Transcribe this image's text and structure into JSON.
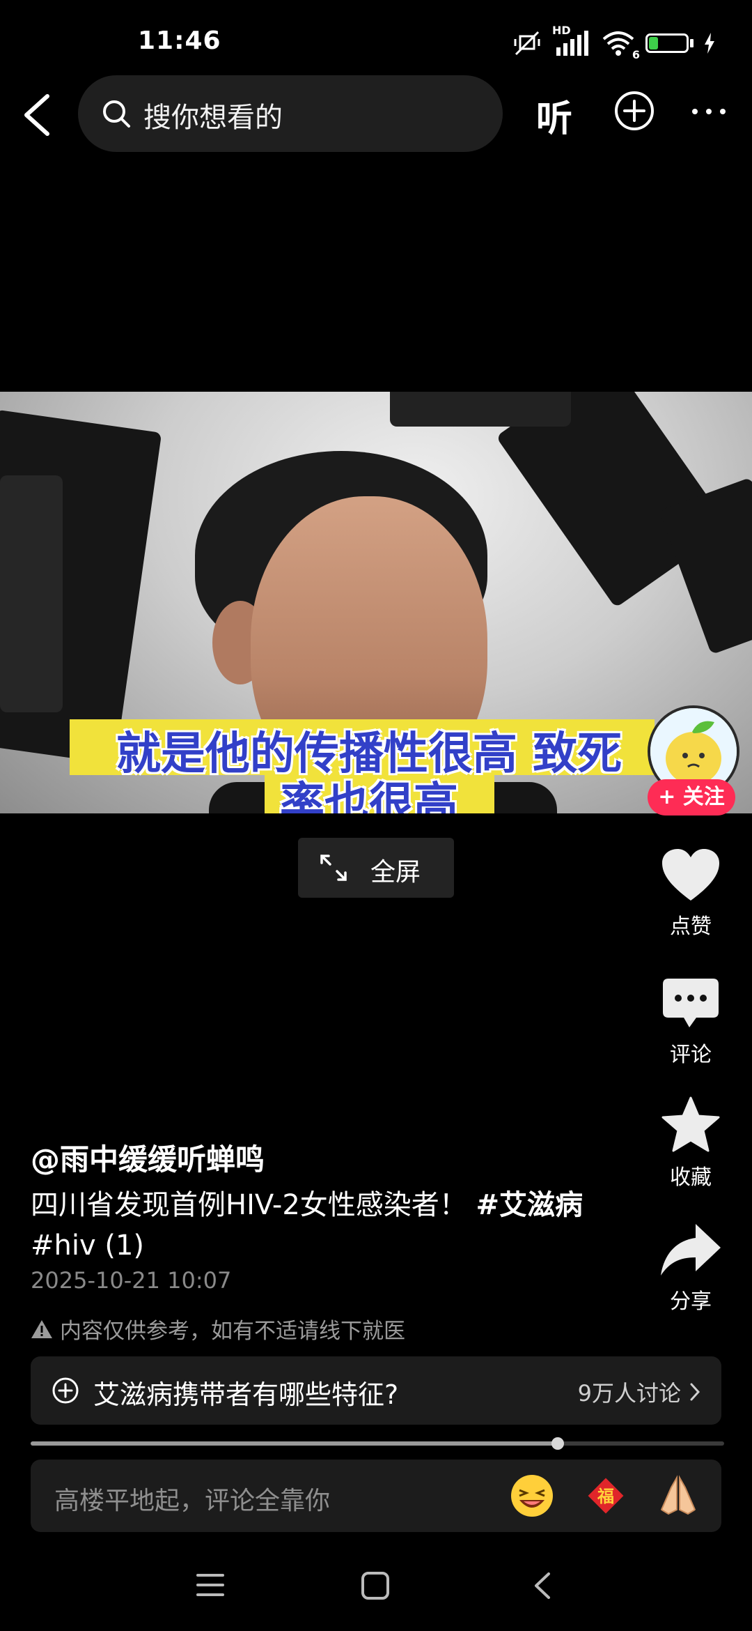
{
  "status_bar": {
    "time": "11:46",
    "network": "HD",
    "battery": "31",
    "battery_level": 0.31,
    "wifi_label": "6"
  },
  "header": {
    "search_placeholder": "搜你想看的",
    "listen_label": "听"
  },
  "video": {
    "subtitle_line1": "就是他的传播性很高 致死",
    "subtitle_line2": "率也很高",
    "follow_label": "+ 关注",
    "fullscreen_label": "全屏"
  },
  "actions": {
    "like": "点赞",
    "comment": "评论",
    "favorite": "收藏",
    "share": "分享"
  },
  "post": {
    "author": "@雨中缓缓听蝉鸣",
    "description": "四川省发现首例HIV-2女性感染者！",
    "tag1": "#艾滋病",
    "tag2": "#hiv",
    "tag_suffix": " (1)",
    "date": "2025-10-21 10:07",
    "notice": "内容仅供参考，如有不适请线下就医"
  },
  "topic": {
    "title": "艾滋病携带者有哪些特征?",
    "discussions": "9万人讨论"
  },
  "progress": {
    "value": 0.76
  },
  "comment_input": {
    "placeholder": "高楼平地起，评论全靠你"
  },
  "colors": {
    "accent": "#fe2c55",
    "subtitle_blue": "#3240c8",
    "subtitle_yellow": "#f1e23b",
    "battery_green": "#3ecf4a"
  }
}
